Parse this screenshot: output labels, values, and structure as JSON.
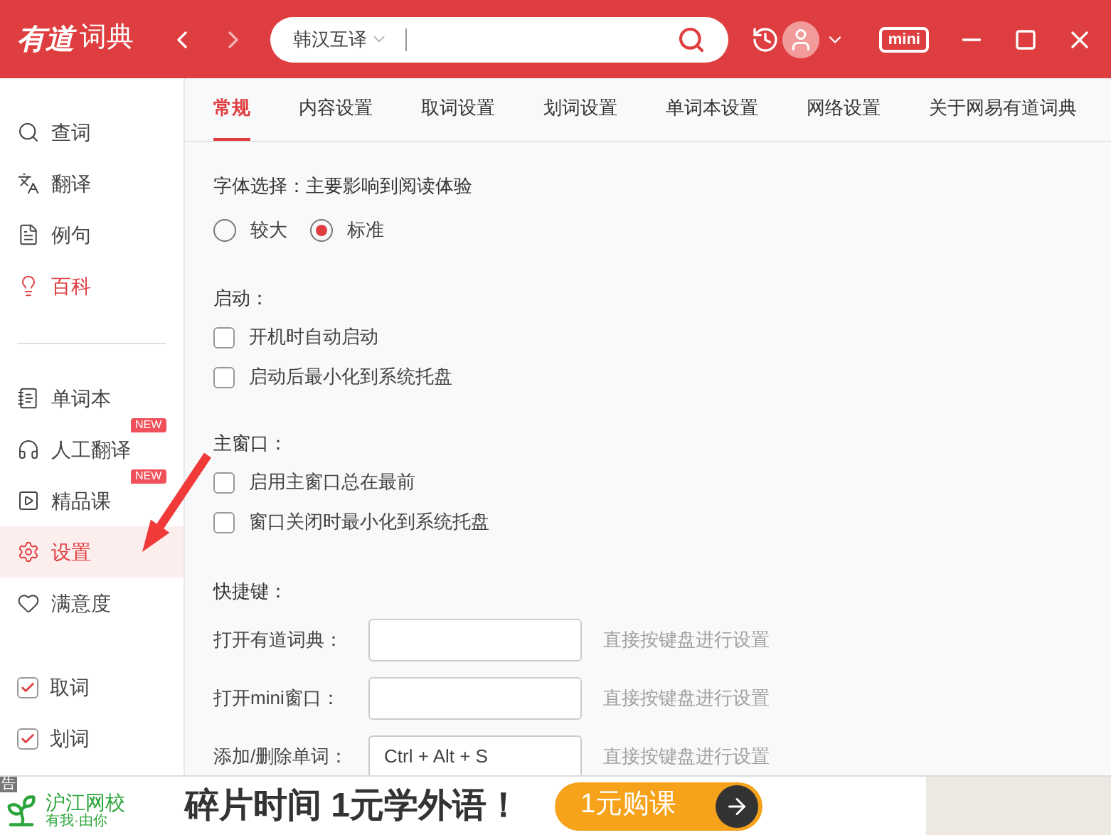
{
  "titlebar": {
    "logo_mark": "有道",
    "logo_text": "词典",
    "search": {
      "mode": "韩汉互译"
    },
    "mini": "mini"
  },
  "sidebar": {
    "groups": [
      {
        "items": [
          {
            "kind": "search",
            "label": "查词",
            "selected": false,
            "accent": false
          },
          {
            "kind": "translate",
            "label": "翻译",
            "selected": false,
            "accent": false
          },
          {
            "kind": "sentence",
            "label": "例句",
            "selected": false,
            "accent": false
          },
          {
            "kind": "bulb",
            "label": "百科",
            "selected": false,
            "accent": true
          }
        ]
      },
      {
        "items": [
          {
            "kind": "book",
            "label": "单词本",
            "selected": false,
            "accent": false
          },
          {
            "kind": "headset",
            "label": "人工翻译",
            "badge": "NEW",
            "selected": false,
            "accent": false
          },
          {
            "kind": "video",
            "label": "精品课",
            "badge": "NEW",
            "selected": false,
            "accent": false
          },
          {
            "kind": "gear",
            "label": "设置",
            "selected": true,
            "accent": false
          },
          {
            "kind": "heart",
            "label": "满意度",
            "selected": false,
            "accent": false
          }
        ]
      },
      {
        "items": [
          {
            "kind": "checkbox",
            "label": "取词",
            "checked": true
          },
          {
            "kind": "checkbox",
            "label": "划词",
            "checked": true
          }
        ]
      }
    ]
  },
  "tabs": [
    {
      "label": "常规",
      "selected": true
    },
    {
      "label": "内容设置",
      "selected": false
    },
    {
      "label": "取词设置",
      "selected": false
    },
    {
      "label": "划词设置",
      "selected": false
    },
    {
      "label": "单词本设置",
      "selected": false
    },
    {
      "label": "网络设置",
      "selected": false
    },
    {
      "label": "关于网易有道词典",
      "selected": false
    }
  ],
  "font_section": {
    "title": "字体选择：主要影响到阅读体验",
    "options": [
      {
        "label": "较大",
        "selected": false
      },
      {
        "label": "标准",
        "selected": true
      }
    ]
  },
  "sections": [
    {
      "title": "启动：",
      "options": [
        {
          "label": "开机时自动启动",
          "checked": false
        },
        {
          "label": "启动后最小化到系统托盘",
          "checked": false
        }
      ]
    },
    {
      "title": "主窗口：",
      "options": [
        {
          "label": "启用主窗口总在最前",
          "checked": false
        },
        {
          "label": "窗口关闭时最小化到系统托盘",
          "checked": false
        }
      ]
    }
  ],
  "hotkeys": {
    "title": "快捷键：",
    "rows": [
      {
        "label": "打开有道词典：",
        "hint": "直接按键盘进行设置"
      },
      {
        "label": "打开mini窗口：",
        "hint": "直接按键盘进行设置"
      },
      {
        "label": "添加/删除单词：",
        "value": "Ctrl + Alt + S",
        "hint": "直接按键盘进行设置"
      }
    ]
  },
  "ad": {
    "tag": "告",
    "brand": "沪江网校",
    "slogan": "有我·由你",
    "headline": "碎片时间 **1元**学外语！",
    "cta": "1元购课"
  }
}
